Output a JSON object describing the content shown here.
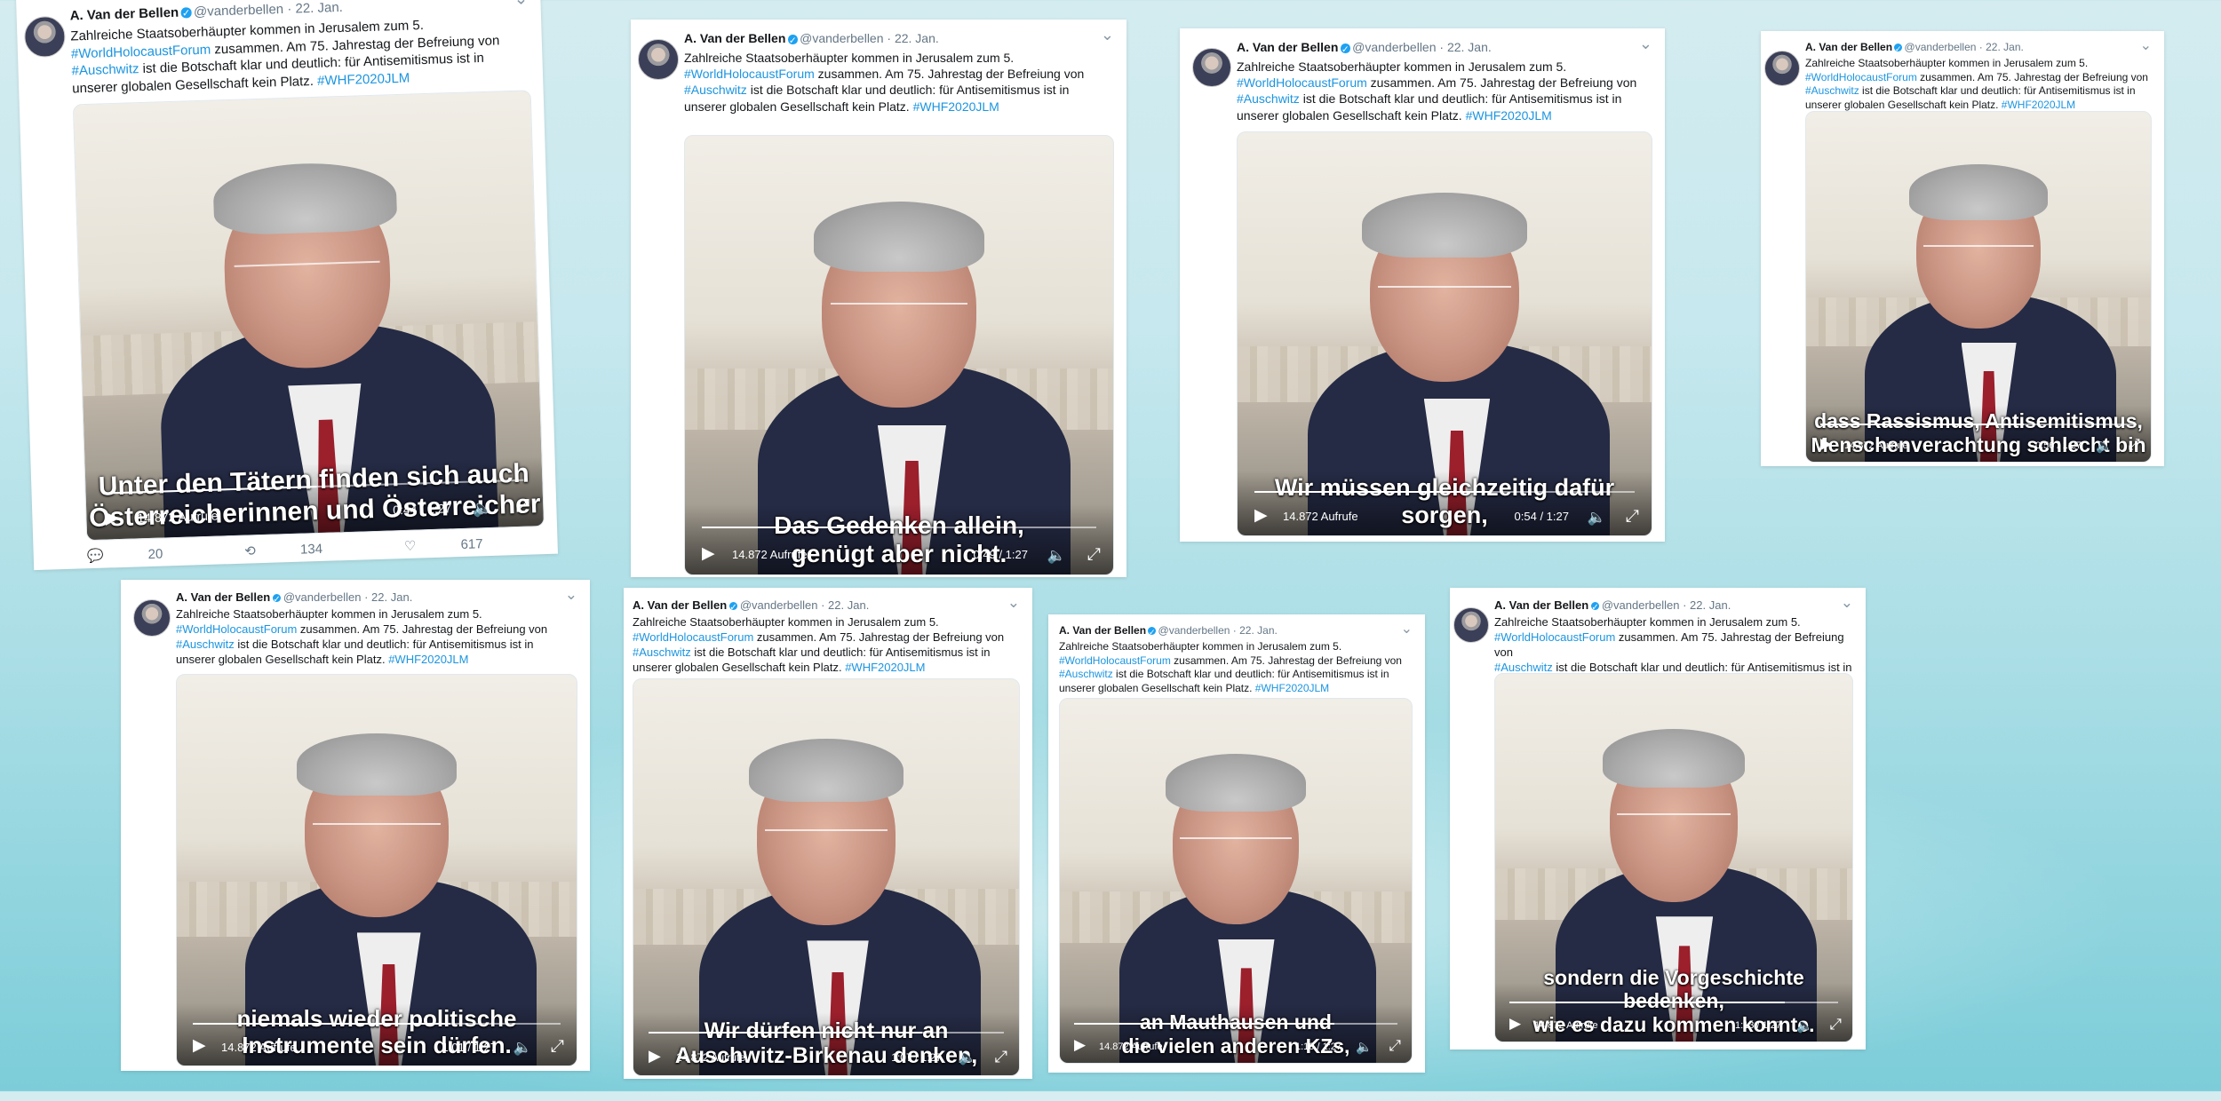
{
  "tweet": {
    "name": "A. Van der Bellen",
    "handle": "@vanderbellen",
    "date": "· 22. Jan.",
    "line1": "Zahlreiche Staatsoberhäupter kommen in Jerusalem zum 5.",
    "tag1": "#WorldHolocaustForum",
    "line2": " zusammen. Am 75. Jahrestag der Befreiung von",
    "tag2": "#Auschwitz",
    "line3": " ist die Botschaft klar und deutlich: für Antisemitismus ist in",
    "line4": "unserer globalen Gesellschaft kein Platz. ",
    "tag3": "#WHF2020JLM"
  },
  "icons": {
    "verified": "verified-badge-icon",
    "caret": "chevron-down-icon",
    "play": "play-icon",
    "volume": "volume-icon",
    "fullscreen": "fullscreen-icon",
    "reply": "reply-icon",
    "retweet": "retweet-icon",
    "like": "heart-icon",
    "share": "share-icon"
  },
  "colors": {
    "link": "#1b95e0",
    "verified": "#1da1f2"
  },
  "cards": [
    {
      "subtitle": [
        "Unter den Tätern finden sich auch",
        "Österreicherinnen und Österreicher"
      ],
      "views": "14.872 Aufrufe",
      "time": "0:44 / 1:27",
      "progress": 0.506,
      "actions": {
        "reply": "20",
        "retweet": "134",
        "like": "617"
      }
    },
    {
      "subtitle": [
        "Das Gedenken allein,",
        "genügt aber nicht."
      ],
      "views": "14.872 Aufrufe",
      "time": "0:49 / 1:27",
      "progress": 0.563
    },
    {
      "subtitle": [
        "Wir müssen gleichzeitig dafür sorgen,"
      ],
      "views": "14.872 Aufrufe",
      "time": "0:54 / 1:27",
      "progress": 0.621
    },
    {
      "subtitle": [
        "dass Rassismus, Antisemitismus,",
        "Menschenverachtung schlecht bin"
      ],
      "views": "14.872 Aufrufe",
      "time": "0:56 / 1:27",
      "progress": 0.644
    },
    {
      "subtitle": [
        "niemals wieder politische",
        "Instrumente sein dürfen."
      ],
      "views": "14.872 Aufrufe",
      "time": "1:01 / 1:27",
      "progress": 0.701
    },
    {
      "subtitle": [
        "Wir dürfen nicht nur an",
        "Auschwitz-Birkenau denken,"
      ],
      "views": "14.872 Aufrufe",
      "time": "1:07 / 1:27",
      "progress": 0.77
    },
    {
      "subtitle": [
        "an Mauthausen und",
        "die vielen anderen KZs,"
      ],
      "views": "14.872 Aufrufe",
      "time": "1:10 / 1:27",
      "progress": 0.805
    },
    {
      "subtitle": [
        "sondern die Vorgeschichte bedenken,",
        "wie es dazu kommen konnte."
      ],
      "views": "14.872 Aufrufe",
      "time": "1:13 / 1:27",
      "progress": 0.839
    }
  ]
}
